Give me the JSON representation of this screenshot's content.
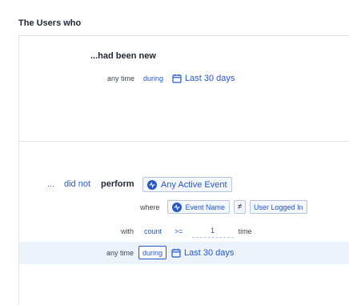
{
  "heading": "The Users who",
  "group1": {
    "title": "...had been new",
    "time_prefix": "any time",
    "time_mode": "during",
    "date_range": "Last 30 days"
  },
  "group2": {
    "ellipsis": "...",
    "negation": "did not",
    "verb": "perform",
    "event": "Any Active Event",
    "where_label": "where",
    "property": "Event Name",
    "operator": "≠",
    "property_value": "User Logged In",
    "with_label": "with",
    "metric": "count",
    "comparator": ">=",
    "count_value": "1",
    "count_unit": "time",
    "time_prefix": "any time",
    "time_mode": "during",
    "date_range": "Last 30 days"
  },
  "colors": {
    "accent": "#2557c9",
    "highlight": "#edf3fb",
    "border": "#dfe3e8"
  },
  "icons": {
    "calendar": "calendar-icon",
    "event": "activity-icon"
  }
}
